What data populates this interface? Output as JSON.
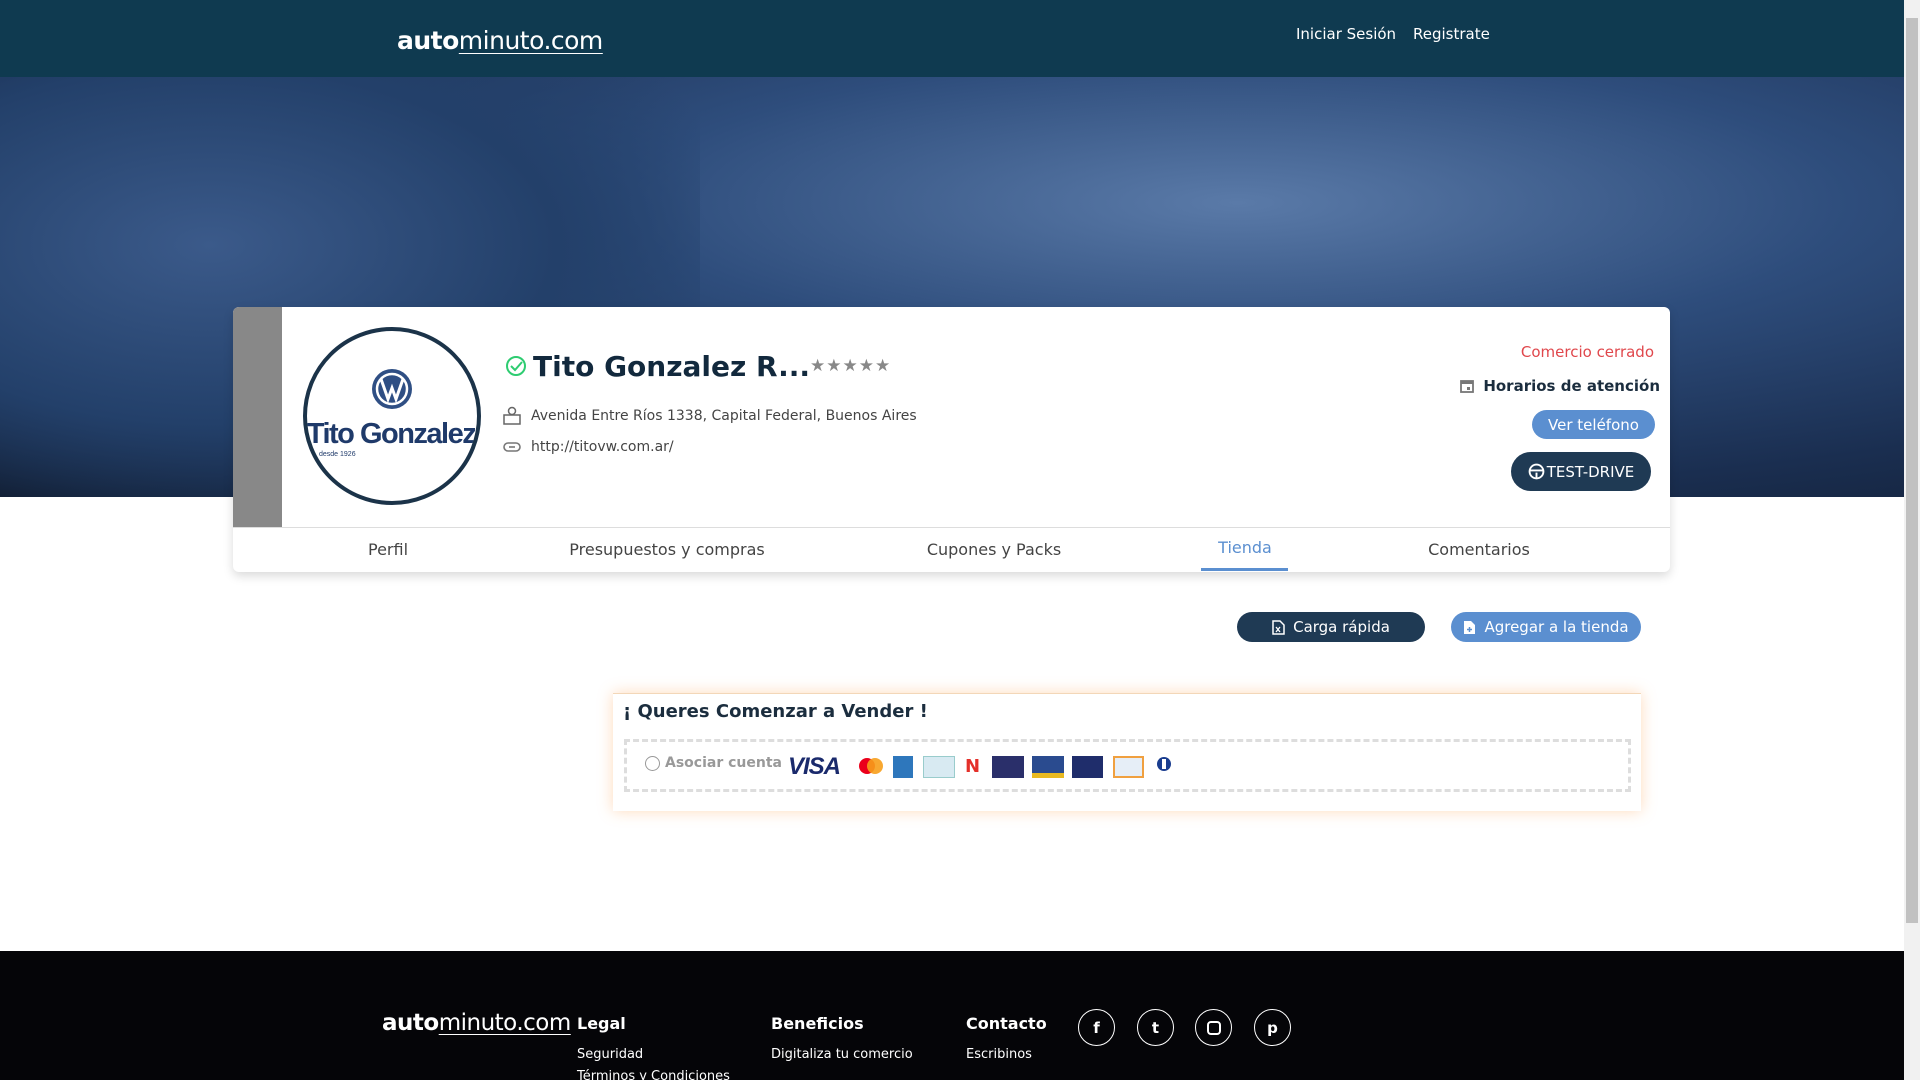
{
  "header": {
    "logo_bold": "auto",
    "logo_rest": "minuto.com",
    "login": "Iniciar Sesión",
    "register": "Registrate"
  },
  "shop": {
    "name": "Tito Gonzalez R...",
    "rating": 0,
    "rating_max": 5,
    "address": "Avenida Entre Ríos 1338, Capital Federal, Buenos Aires",
    "website": "http://titovw.com.ar/",
    "logo_text": "Tito Gonzalez",
    "logo_sub": "desde 1926",
    "status": "Comercio cerrado",
    "hours_label": "Horarios de atención",
    "phone_button": "Ver teléfono",
    "testdrive_button": "TEST-DRIVE"
  },
  "tabs": [
    {
      "label": "Perfil"
    },
    {
      "label": "Presupuestos y compras"
    },
    {
      "label": "Cupones y Packs"
    },
    {
      "label": "Tienda",
      "active": true
    },
    {
      "label": "Comentarios"
    }
  ],
  "actions": {
    "quick_load": "Carga rápida",
    "add_store": "Agregar a la tienda"
  },
  "sell": {
    "title": "¡ Queres Comenzar a Vender !",
    "associate": "Asociar cuenta",
    "cards": [
      "VISA",
      "Mastercard",
      "American Express",
      "Mercado Pago",
      "Naranja",
      "Nativa",
      "Tarjeta Shopping",
      "Cabal",
      "Argencard",
      "Diners Club"
    ]
  },
  "footer": {
    "legal": "Legal",
    "legal_links": [
      "Seguridad",
      "Términos y Condiciones"
    ],
    "benefits": "Beneficios",
    "benefits_links": [
      "Digitaliza tu comercio"
    ],
    "contact": "Contacto",
    "contact_links": [
      "Escribinos"
    ],
    "social": [
      "facebook",
      "twitter",
      "instagram",
      "pinterest"
    ]
  },
  "colors": {
    "topbar": "#0f3a50",
    "accent": "#5b8fd0",
    "dark_button": "#1f3a54",
    "closed": "#e0474c",
    "verified": "#2ecc71"
  }
}
